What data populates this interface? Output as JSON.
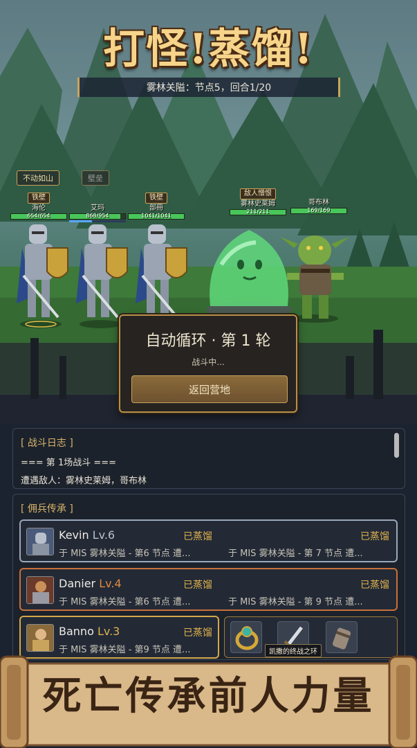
{
  "title": "打怪!蒸馏!",
  "stage_info": "雾林关隘：节点5，回合1/20",
  "party_tags": [
    "不动如山",
    "壁垒"
  ],
  "party": [
    {
      "badge": "铁壁",
      "name": "海伦",
      "hp": "654/654",
      "hp_fraction": 1.0
    },
    {
      "badge": "",
      "name": "艾玛",
      "hp": "868/954",
      "hp_fraction": 0.91
    },
    {
      "badge": "铁壁",
      "name": "部冊",
      "hp": "1041/1041",
      "hp_fraction": 1.0
    }
  ],
  "enemy_tag": "敌人憎恨",
  "enemies": [
    {
      "name": "雾林史莱姆",
      "hp": "211/211",
      "hp_fraction": 1.0
    },
    {
      "name": "哥布林",
      "hp": "169/169",
      "hp_fraction": 1.0
    }
  ],
  "dialog": {
    "title": "自动循环 · 第 1 轮",
    "subtitle": "战斗中...",
    "button": "返回营地"
  },
  "log": {
    "header": "[ 战斗日志 ]",
    "lines": [
      "=== 第 1场战斗 ===",
      "遭遇敌人：雾林史莱姆，哥布林"
    ]
  },
  "mercenaries": {
    "header": "[ 佣兵传承 ]",
    "rows": [
      {
        "name": "Kevin",
        "level": "Lv.6",
        "level_color": "#b9c2cf",
        "border": "#9aa8bb",
        "status1": "已蒸馏",
        "status2": "已蒸馏",
        "desc1": "于 MIS 雾林关隘 - 第6 节点 遭...",
        "desc2": "于 MIS 雾林关隘 - 第 7 节点 遭..."
      },
      {
        "name": "Danier",
        "level": "Lv.4",
        "level_color": "#e08a3e",
        "border": "#c9703a",
        "status1": "已蒸馏",
        "status2": "已蒸馏",
        "desc1": "于 MIS 雾林关隘 - 第6 节点 遭...",
        "desc2": "于 MIS 雾林关隘 - 第 9 节点 遭..."
      },
      {
        "name": "Banno",
        "level": "Lv.3",
        "level_color": "#e0b24e",
        "border": "#d4a84a",
        "status1": "已蒸馏",
        "status2": "",
        "desc1": "于 MIS 雾林关隘 - 第9 节点 遭...",
        "desc2": ""
      }
    ]
  },
  "item_tooltip": "凯撒的终战之环",
  "banner_text": "死亡传承前人力量",
  "colors": {
    "gold": "#c9a45c",
    "hp_green": "#49c65a",
    "accent_orange": "#e0b24e"
  }
}
